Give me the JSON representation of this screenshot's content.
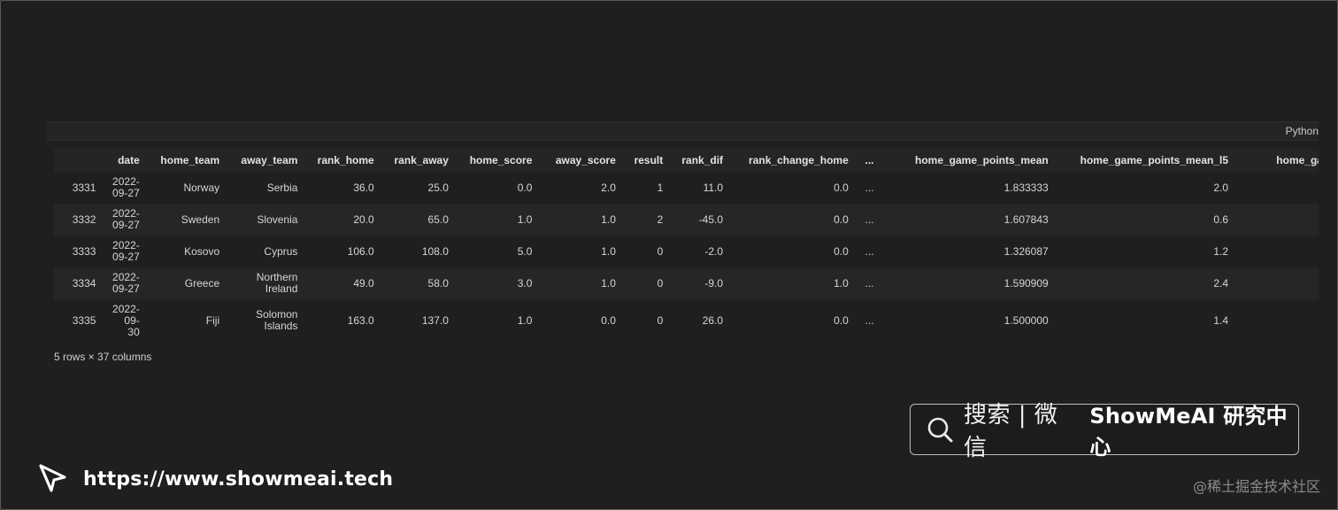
{
  "cell": {
    "language": "Python"
  },
  "table": {
    "columns": [
      "",
      "date",
      "home_team",
      "away_team",
      "rank_home",
      "rank_away",
      "home_score",
      "away_score",
      "result",
      "rank_dif",
      "rank_change_home",
      "...",
      "home_game_points_mean",
      "home_game_points_mean_l5",
      "home_game_points_ra"
    ],
    "rows": [
      {
        "index": "3331",
        "date": "2022-\n09-27",
        "home_team": "Norway",
        "away_team": "Serbia",
        "rank_home": "36.0",
        "rank_away": "25.0",
        "home_score": "0.0",
        "away_score": "2.0",
        "result": "1",
        "rank_dif": "11.0",
        "rank_change_home": "0.0",
        "ellipsis": "...",
        "home_game_points_mean": "1.833333",
        "home_game_points_mean_l5": "2.0",
        "home_game_points_ra": ""
      },
      {
        "index": "3332",
        "date": "2022-\n09-27",
        "home_team": "Sweden",
        "away_team": "Slovenia",
        "rank_home": "20.0",
        "rank_away": "65.0",
        "home_score": "1.0",
        "away_score": "1.0",
        "result": "2",
        "rank_dif": "-45.0",
        "rank_change_home": "0.0",
        "ellipsis": "...",
        "home_game_points_mean": "1.607843",
        "home_game_points_mean_l5": "0.6",
        "home_game_points_ra": ""
      },
      {
        "index": "3333",
        "date": "2022-\n09-27",
        "home_team": "Kosovo",
        "away_team": "Cyprus",
        "rank_home": "106.0",
        "rank_away": "108.0",
        "home_score": "5.0",
        "away_score": "1.0",
        "result": "0",
        "rank_dif": "-2.0",
        "rank_change_home": "0.0",
        "ellipsis": "...",
        "home_game_points_mean": "1.326087",
        "home_game_points_mean_l5": "1.2",
        "home_game_points_ra": ""
      },
      {
        "index": "3334",
        "date": "2022-\n09-27",
        "home_team": "Greece",
        "away_team": "Northern\nIreland",
        "rank_home": "49.0",
        "rank_away": "58.0",
        "home_score": "3.0",
        "away_score": "1.0",
        "result": "0",
        "rank_dif": "-9.0",
        "rank_change_home": "1.0",
        "ellipsis": "...",
        "home_game_points_mean": "1.590909",
        "home_game_points_mean_l5": "2.4",
        "home_game_points_ra": ""
      },
      {
        "index": "3335",
        "date": "2022-\n09-\n30",
        "home_team": "Fiji",
        "away_team": "Solomon\nIslands",
        "rank_home": "163.0",
        "rank_away": "137.0",
        "home_score": "1.0",
        "away_score": "0.0",
        "result": "0",
        "rank_dif": "26.0",
        "rank_change_home": "0.0",
        "ellipsis": "...",
        "home_game_points_mean": "1.500000",
        "home_game_points_mean_l5": "1.4",
        "home_game_points_ra": ""
      }
    ],
    "summary": "5 rows × 37 columns"
  },
  "watermark": {
    "search_cn": "搜索 | 微信",
    "brand": "ShowMeAI 研究中心",
    "url": "https://www.showmeai.tech",
    "credit": "@稀土掘金技术社区"
  }
}
